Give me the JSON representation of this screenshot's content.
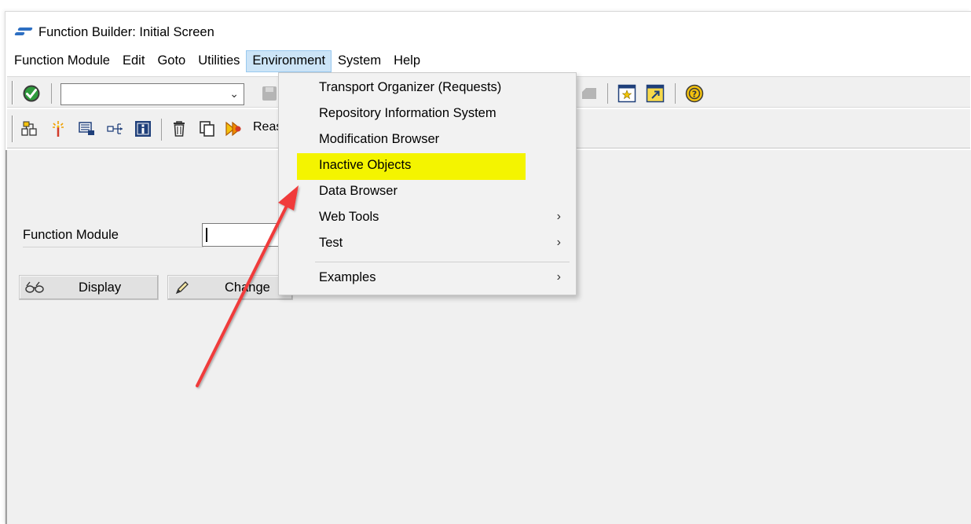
{
  "window": {
    "title": "Function Builder: Initial Screen"
  },
  "menubar": {
    "items": [
      {
        "label": "Function Module"
      },
      {
        "label": "Edit"
      },
      {
        "label": "Goto"
      },
      {
        "label": "Utilities"
      },
      {
        "label": "Environment",
        "active": true
      },
      {
        "label": "System"
      },
      {
        "label": "Help"
      }
    ]
  },
  "toolbar": {
    "command_field_value": "",
    "reassign_label": "Reas"
  },
  "form": {
    "function_module_label": "Function Module",
    "function_module_value": "",
    "display_button_label": "Display",
    "change_button_label": "Change"
  },
  "environment_menu": {
    "items": [
      {
        "label": "Transport Organizer (Requests)",
        "submenu": false
      },
      {
        "label": "Repository Information System",
        "submenu": false
      },
      {
        "label": "Modification Browser",
        "submenu": false
      },
      {
        "label": "Inactive Objects",
        "submenu": false,
        "highlighted": true
      },
      {
        "label": "Data Browser",
        "submenu": false
      },
      {
        "label": "Web Tools",
        "submenu": true
      },
      {
        "label": "Test",
        "submenu": true
      },
      {
        "label": "Examples",
        "submenu": true
      }
    ],
    "submenu_arrow": "›"
  },
  "colors": {
    "highlight": "#f4f400",
    "annotation_arrow": "#f03a3a",
    "menu_active_bg": "#cce4f7"
  }
}
